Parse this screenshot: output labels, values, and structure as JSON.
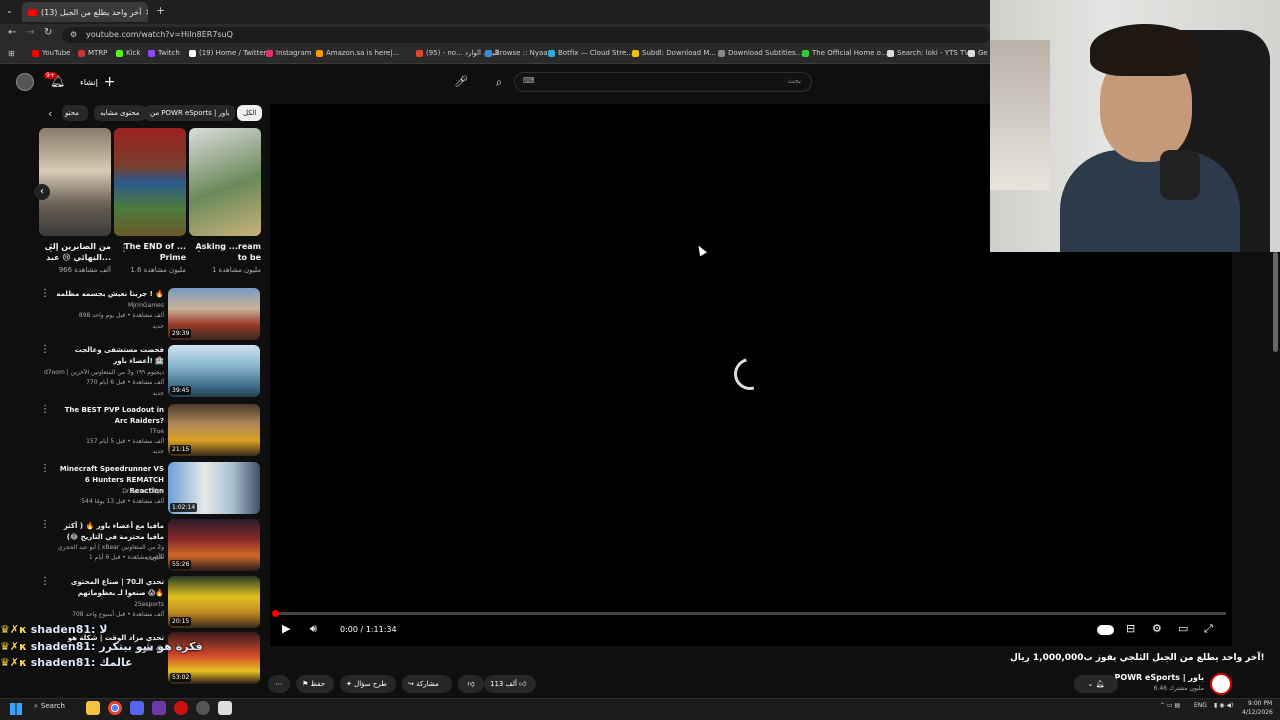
{
  "browser": {
    "tab_title": "(13) آخر واحد يطلع من الجبل",
    "new_tab": "+",
    "url": "youtube.com/watch?v=HiIn8ER7suQ",
    "bookmarks": [
      {
        "label": "YouTube",
        "color": "#ff0000"
      },
      {
        "label": "MTRP",
        "color": "#c33"
      },
      {
        "label": "Kick",
        "color": "#53fc18"
      },
      {
        "label": "Twitch",
        "color": "#9146ff"
      },
      {
        "label": "(19) Home / Twitter",
        "color": "#ffffff"
      },
      {
        "label": "Instagram",
        "color": "#e1306c"
      },
      {
        "label": "Amazon.sa is here|...",
        "color": "#ff9900"
      },
      {
        "label": "(95) - no... البريد الوارد",
        "color": "#ea4335"
      },
      {
        "label": "Browse :: Nyaa",
        "color": "#3a8ddb"
      },
      {
        "label": "Botfix — Cloud Stre...",
        "color": "#3ad"
      },
      {
        "label": "Subdl: Download M...",
        "color": "#f4c20d"
      },
      {
        "label": "Download Subtitles...",
        "color": "#888"
      },
      {
        "label": "The Official Home o...",
        "color": "#3c3"
      },
      {
        "label": "Search: loki - YTS TV",
        "color": "#ddd"
      },
      {
        "label": "Ge",
        "color": "#ddd"
      }
    ]
  },
  "youtube": {
    "create_label": "إنشاء",
    "notif_count": "9+",
    "search_placeholder": "بحث",
    "chips": [
      "الكل",
      "من POWR eSports | باور",
      "محتوى مشابه",
      "محتو"
    ],
    "shorts": [
      {
        "title": "Asking ...ream to be",
        "views": "1 مليون مشاهدة"
      },
      {
        "title": "The END of ... Prime",
        "views": "1.6 مليون مشاهدة"
      },
      {
        "title": "من الصابرين إلى النهائي 😢 عبد...",
        "views": "966 ألف مشاهدة"
      }
    ],
    "recommendations": [
      {
        "title": "جربنا نعيش بجسمه مظلمه ! 🔥",
        "channel": "MjrmGames",
        "meta": "898 ألف مشاهدة • قبل يوم واحد",
        "badge": "جديد",
        "duration": "29:39"
      },
      {
        "title": "فحصت مستشفى وعالجت أعضاء باور! 🏥",
        "channel": "d7oom | ديجيوم ١٩٩ و3 من المتعاونين الآخرين",
        "meta": "770 ألف مشاهدة • قبل 6 أيام",
        "badge": "جديد",
        "duration": "39:45"
      },
      {
        "title": "The BEST PVP Loadout in Arc Raiders?",
        "channel": "TFue",
        "meta": "157 ألف مشاهدة • قبل 5 أيام",
        "badge": "جديد",
        "duration": "21:15"
      },
      {
        "title": "Minecraft Speedrunner VS 6 Hunters REMATCH Reaction",
        "channel": "DrDonut Clips",
        "meta": "544 ألف مشاهدة • قبل 13 يومًا",
        "badge": "",
        "duration": "1:02:14"
      },
      {
        "title": "مافيا مع أعضاء باور 🔥 ( أكثر مافيا محترمة في التاريخ 😂)",
        "channel": "أبو عبد الحجري | xBear و2 من المتعاونين الآخرين",
        "meta": "1 مليون مشاهدة • قبل 6 أيام",
        "badge": "",
        "duration": "55:26"
      },
      {
        "title": "تحدي الـ70 | صناع المحتوى صنعوا لـ بعظوماتهم 😱🔥",
        "channel": "25esports",
        "meta": "708 ألف مشاهدة • قبل أسبوع واحد",
        "badge": "",
        "duration": "20:15"
      },
      {
        "title": "تحدي مزاد الوقت | شكلة هو شو 😂",
        "channel": "",
        "meta": "",
        "badge": "",
        "duration": "53:02"
      }
    ]
  },
  "player": {
    "time": "0:00 / 1:11:34"
  },
  "video": {
    "title": "آخر واحد يطلع من الجبل الثلجي يفوز ب1,000,000 ريال!",
    "channel": "POWR eSports | باور",
    "subscribers": "6.46 مليون مشترك",
    "likes": "113 ألف",
    "share": "مشاركة",
    "ask": "طرح سؤال",
    "save": "حفظ"
  },
  "chat": [
    {
      "user": "shaden81:",
      "msg": "لا"
    },
    {
      "user": "shaden81:",
      "msg": "فكرة هو شو بيتكرر"
    },
    {
      "user": "shaden81:",
      "msg": "عالمك"
    }
  ],
  "taskbar": {
    "search": "Search",
    "lang": "ENG",
    "time": "9:00 PM",
    "date": "4/12/2026"
  },
  "colors": {
    "accent": "#ff0000",
    "bg": "#0f0f0f"
  }
}
